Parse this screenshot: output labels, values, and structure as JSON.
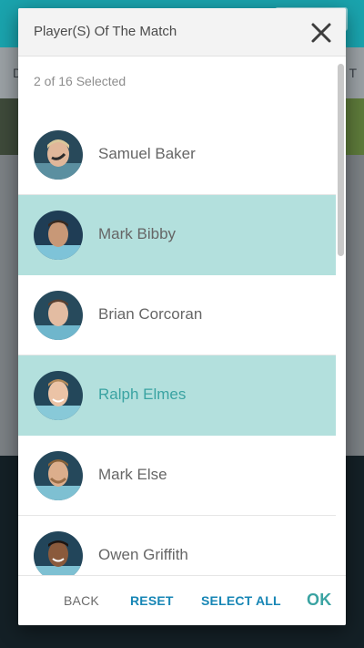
{
  "dialog": {
    "title": "Player(S) Of The Match",
    "selected_count": "2 of 16 Selected"
  },
  "players": [
    {
      "name": "Samuel Baker",
      "selected": false
    },
    {
      "name": "Mark Bibby",
      "selected": true
    },
    {
      "name": "Brian Corcoran",
      "selected": false
    },
    {
      "name": "Ralph Elmes",
      "selected": true
    },
    {
      "name": "Mark Else",
      "selected": false
    },
    {
      "name": "Owen Griffith",
      "selected": false
    }
  ],
  "footer": {
    "back": "BACK",
    "reset": "RESET",
    "select_all": "SELECT ALL",
    "ok": "OK"
  },
  "background": {
    "subbar_left": "D",
    "subbar_right": "T"
  },
  "colors": {
    "selected_row": "#b3e0dd",
    "accent_teal": "#3aa3a2",
    "link_blue": "#1786b5",
    "header_bg": "#f3f3f3"
  },
  "icons": {
    "close": "close-icon",
    "avatar": "player-avatar"
  }
}
